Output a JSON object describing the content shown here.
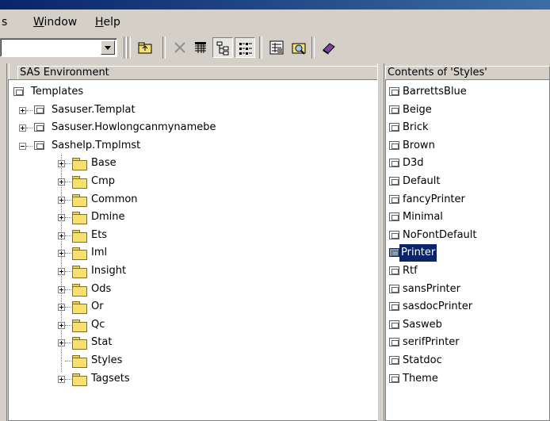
{
  "menubar": {
    "items": [
      {
        "label": "s"
      },
      {
        "label": "Window",
        "mnemonic": "W",
        "rest": "indow"
      },
      {
        "label": "Help",
        "mnemonic": "H",
        "rest": "elp"
      }
    ]
  },
  "toolbar": {
    "combo_value": "",
    "buttons": [
      "up-folder-icon",
      "delete-icon",
      "details-view-icon",
      "tree-view-icon",
      "list-view-icon",
      "properties-icon",
      "find-icon",
      "book-icon"
    ]
  },
  "left_pane": {
    "header": "SAS Environment",
    "root": "Templates",
    "stores": [
      "Sasuser.Templat",
      "Sasuser.Howlongcanmynamebe",
      "Sashelp.Tmplmst"
    ],
    "folders": [
      "Base",
      "Cmp",
      "Common",
      "Dmine",
      "Ets",
      "Iml",
      "Insight",
      "Ods",
      "Or",
      "Qc",
      "Stat",
      "Styles",
      "Tagsets"
    ]
  },
  "right_pane": {
    "header": "Contents of 'Styles'",
    "items": [
      "BarrettsBlue",
      "Beige",
      "Brick",
      "Brown",
      "D3d",
      "Default",
      "fancyPrinter",
      "Minimal",
      "NoFontDefault",
      "Printer",
      "Rtf",
      "sansPrinter",
      "sasdocPrinter",
      "Sasweb",
      "serifPrinter",
      "Statdoc",
      "Theme"
    ],
    "selected": "Printer"
  }
}
